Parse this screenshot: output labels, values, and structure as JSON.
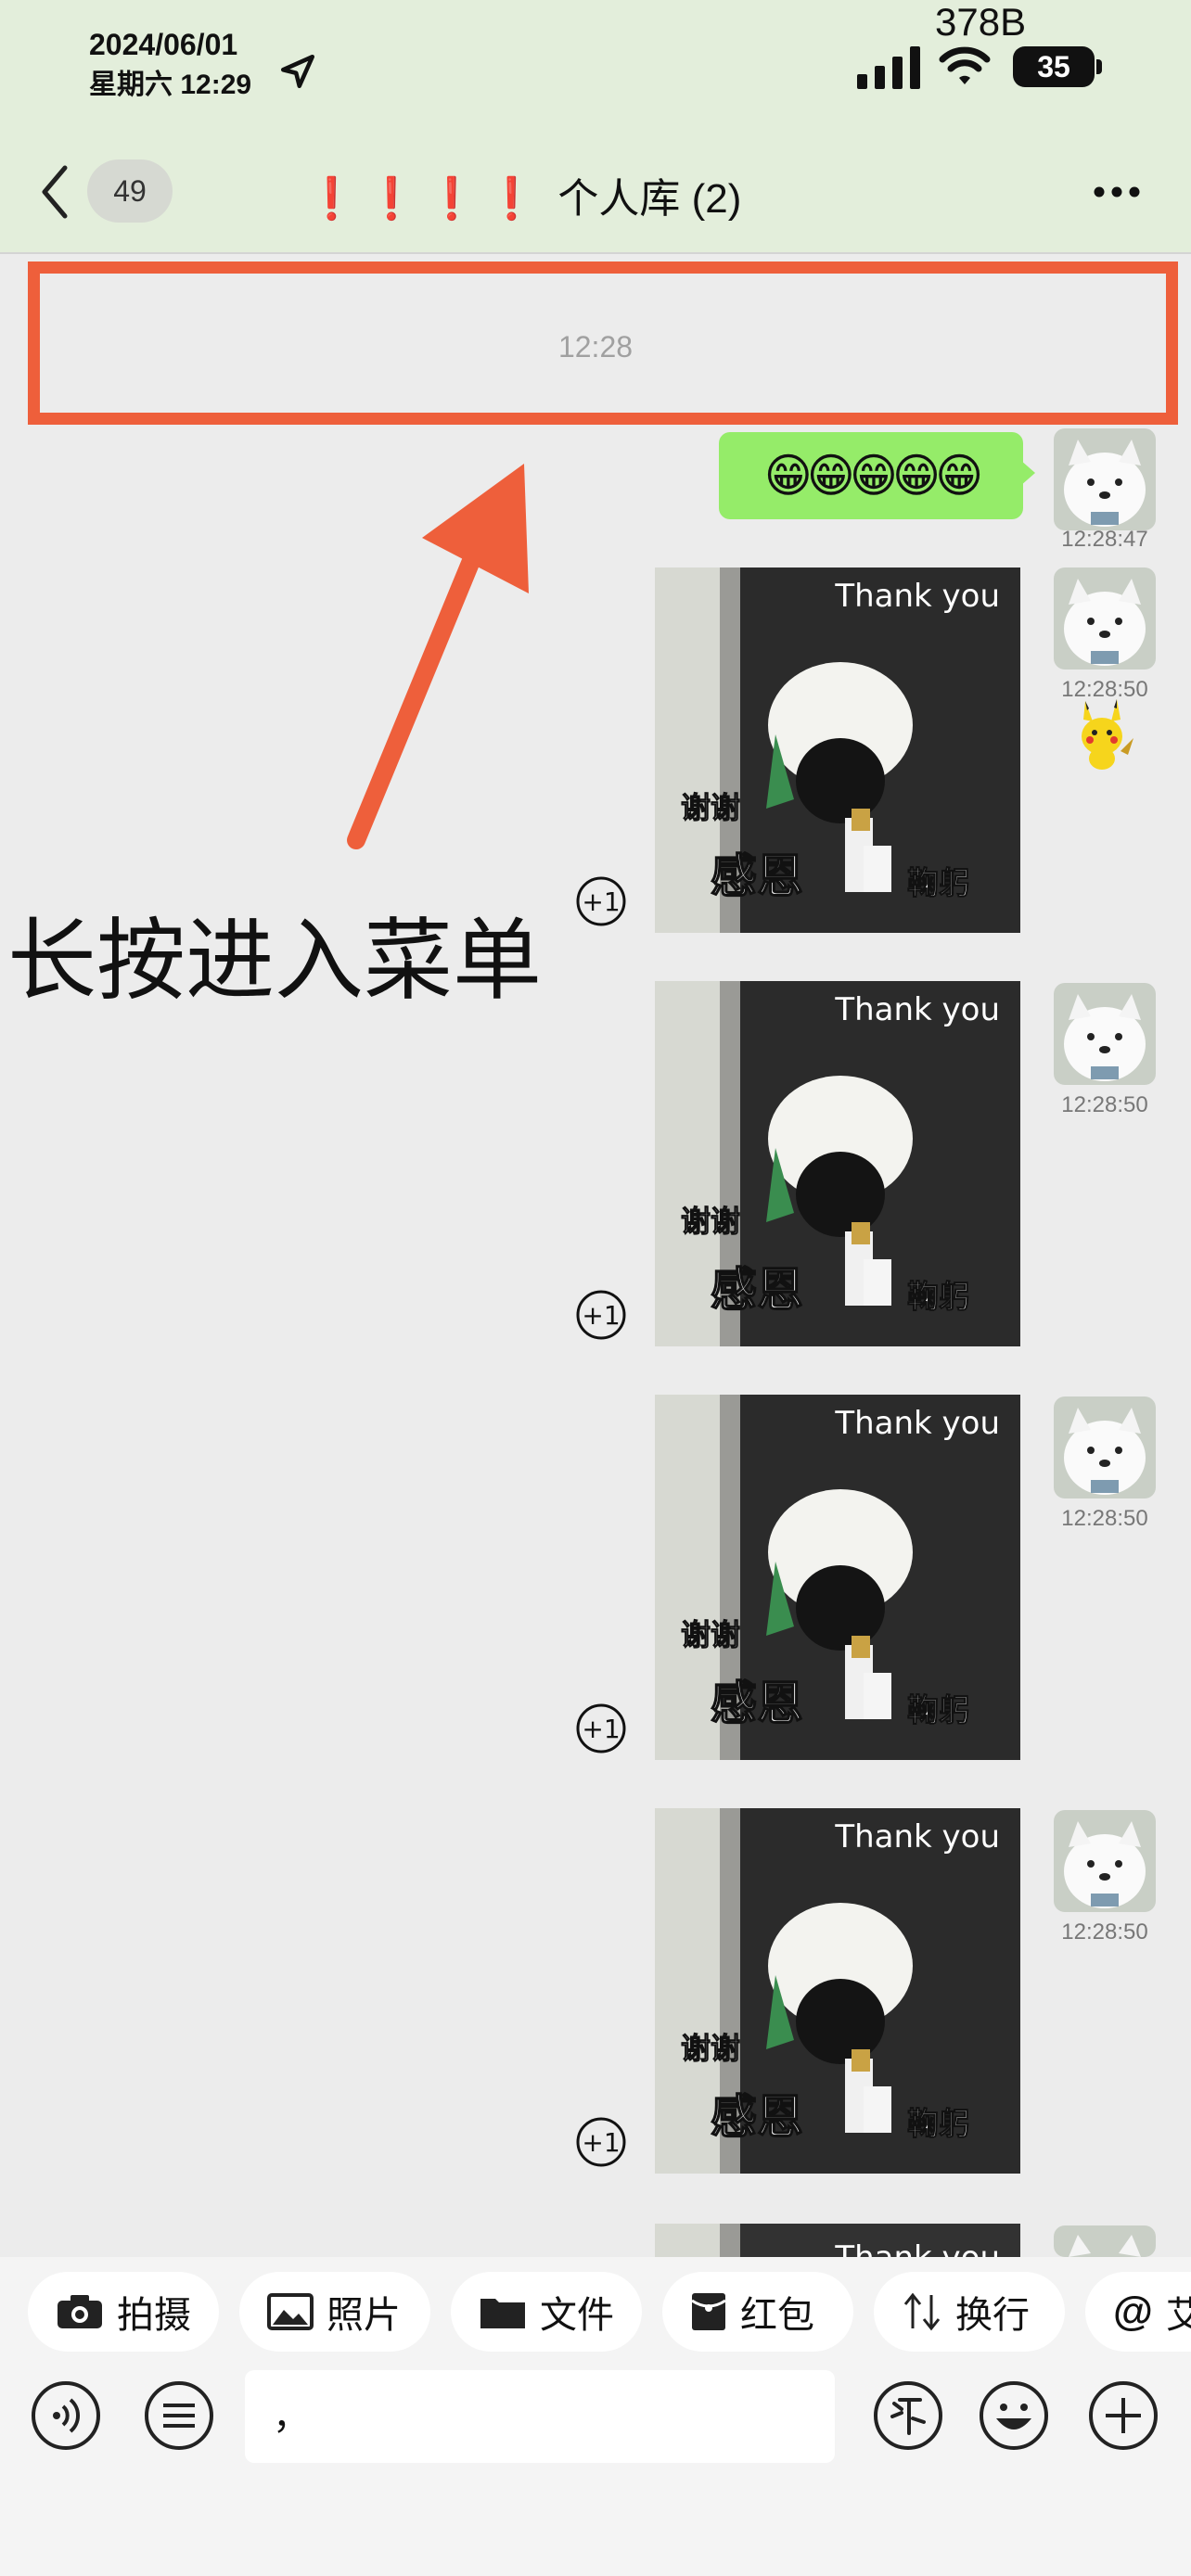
{
  "status_bar": {
    "date": "2024/06/01",
    "weekday_time": "星期六 12:29",
    "net_speed": "378B",
    "battery": "35"
  },
  "header": {
    "back_count": "49",
    "title_marks": "❗❗❗❗",
    "title_text": "个人库 (2)"
  },
  "annotation": {
    "timestamp": "12:28",
    "hint": "长按进入菜单",
    "color": "#ee5f3b"
  },
  "messages": [
    {
      "type": "text",
      "text": "😁😁😁😁😁",
      "time": "12:28:47"
    },
    {
      "type": "sticker",
      "caption_top": "Thank you",
      "caption_mid": "谢谢",
      "caption_bottom_left": "感恩",
      "caption_bottom_right": "鞠躬",
      "time": "12:28:50",
      "plus_one": "+1"
    },
    {
      "type": "sticker",
      "caption_top": "Thank you",
      "caption_mid": "谢谢",
      "caption_bottom_left": "感恩",
      "caption_bottom_right": "鞠躬",
      "time": "12:28:50",
      "plus_one": "+1"
    },
    {
      "type": "sticker",
      "caption_top": "Thank you",
      "caption_mid": "谢谢",
      "caption_bottom_left": "感恩",
      "caption_bottom_right": "鞠躬",
      "time": "12:28:50",
      "plus_one": "+1"
    },
    {
      "type": "sticker",
      "caption_top": "Thank you",
      "caption_mid": "谢谢",
      "caption_bottom_left": "感恩",
      "caption_bottom_right": "鞠躬",
      "time": "12:28:50",
      "plus_one": "+1"
    },
    {
      "type": "sticker",
      "caption_top": "Thank you"
    }
  ],
  "toolbar": {
    "chips": [
      {
        "label": "拍摄",
        "icon": "camera-icon"
      },
      {
        "label": "照片",
        "icon": "photo-icon"
      },
      {
        "label": "文件",
        "icon": "folder-icon"
      },
      {
        "label": "红包",
        "icon": "red-packet-icon"
      },
      {
        "label": "换行",
        "icon": "newline-icon"
      },
      {
        "label": "艾",
        "icon": "at-icon",
        "prefix": "@"
      }
    ]
  },
  "input": {
    "value": "，"
  },
  "colors": {
    "header_bg": "#e3eedb",
    "bubble": "#95ec69",
    "accent_red": "#e2231a"
  }
}
